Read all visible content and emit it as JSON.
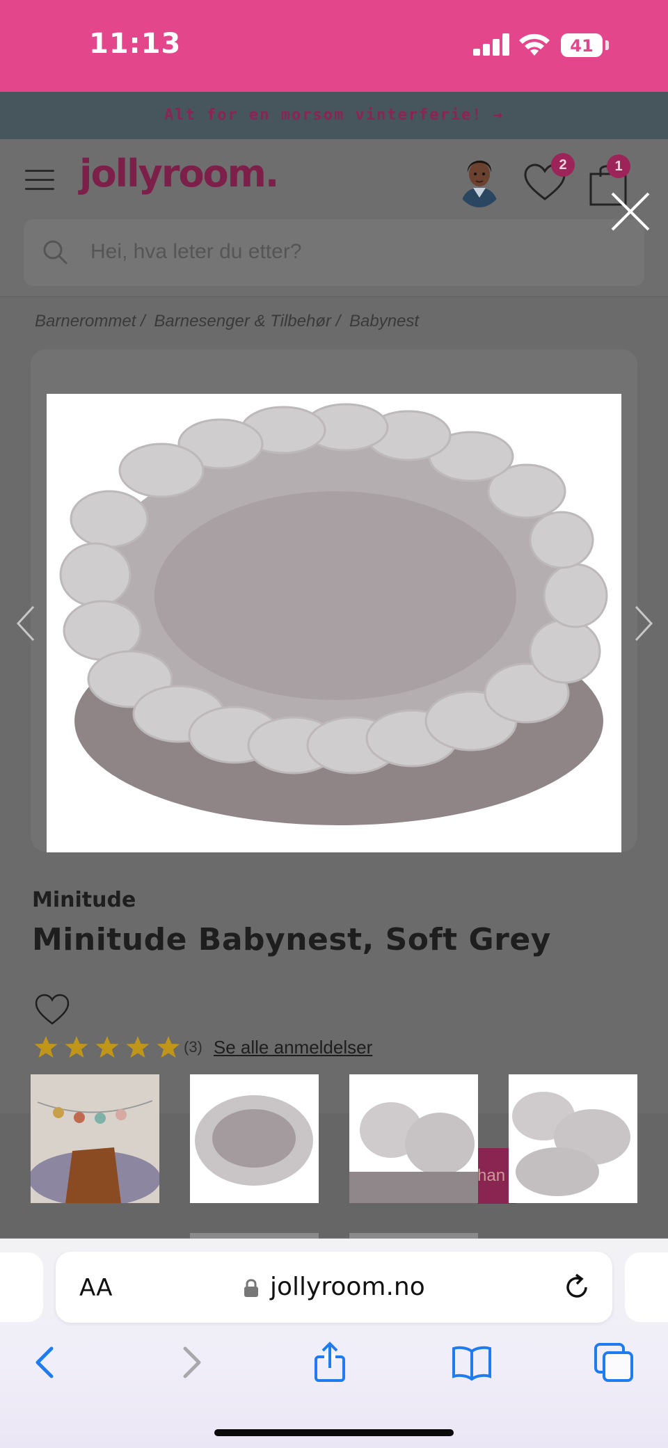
{
  "status_bar": {
    "time": "11:13",
    "battery": "41",
    "battery_level": 0.41
  },
  "promo": {
    "text": "Alt for en morsom vinterferie! →"
  },
  "header": {
    "logo": "jollyroom.",
    "wishlist_count": "2",
    "cart_count": "1",
    "search_placeholder": "Hei, hva leter du etter?"
  },
  "breadcrumb": [
    {
      "label": "Barnerommet /"
    },
    {
      "label": "Barnesenger & Tilbehør /"
    },
    {
      "label": "Babynest"
    }
  ],
  "product": {
    "brand": "Minitude",
    "title": "Minitude Babynest, Soft Grey",
    "rating": 5,
    "review_count": "(3)",
    "review_link": "Se alle anmeldelser"
  },
  "sticky": {
    "cta_text": "han"
  },
  "browser": {
    "text_size_label": "AA",
    "url": "jollyroom.no"
  },
  "colors": {
    "status_bar": "#e3468a",
    "brand": "#7c1f49",
    "badge": "#9c2459",
    "star": "#c0961a",
    "safari_blue": "#1e7bf0"
  }
}
